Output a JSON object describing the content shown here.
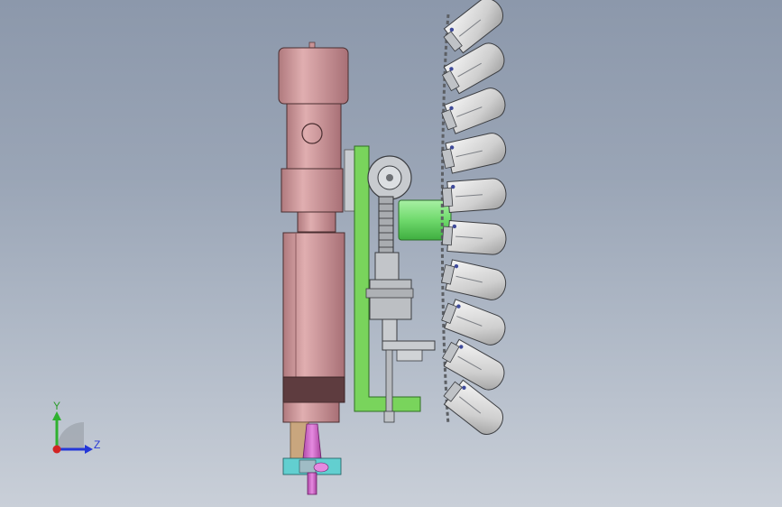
{
  "triad": {
    "y_label": "Y",
    "z_label": "Z",
    "colors": {
      "y": "#2fb12f",
      "z": "#2437d8",
      "x": "#d22424",
      "sphere": "#9aa0aa"
    }
  },
  "colors": {
    "motor": "#c98f92",
    "motor_dark": "#a86d72",
    "motor_band": "#5a3a3c",
    "plate": "#76d15a",
    "plate_edge": "#2f6e22",
    "shaft": "#7ee07c",
    "tool_holder": "#d56ad0",
    "tool_base": "#60cfd0",
    "grey_parts": "#b9bcbf",
    "grey_dark": "#6e7175",
    "pocket": "#d8d8d8"
  },
  "magazine": {
    "pocket_count": 10
  }
}
